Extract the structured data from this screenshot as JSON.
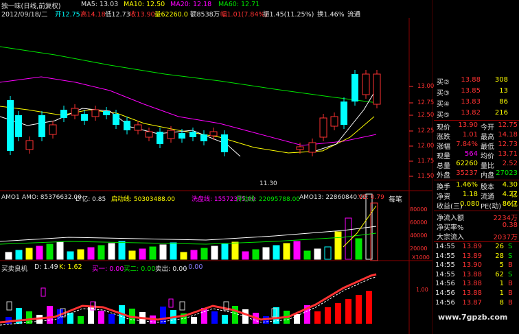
{
  "header": {
    "title": "独一味(日线,前复权)",
    "ma5": "MA5: 13.03",
    "ma10": "MA10: 12.50",
    "ma20": "MA20: 12.18",
    "ma60": "MA60: 12.71",
    "date": "2012/09/18/二",
    "open": "开12.75",
    "high": "高14.18",
    "low": "低12.73",
    "close": "收13.90",
    "volume": "量62260.0",
    "amount": "额8538万",
    "change": "幅1.01(7.84%)",
    "amplitude": "振1.45(11.25%)",
    "turnover": "换1.46%",
    "liquidity": "流通"
  },
  "price_axis": [
    "13.00",
    "12.75",
    "12.50",
    "12.25",
    "12.00",
    "11.75",
    "11.50"
  ],
  "low_marker": "11.30",
  "amo_panel": {
    "label": "AMO1",
    "amo": "AMO: 85376632.00",
    "lt": "LT亿: 0.85",
    "start": "启动线: 50303488.00",
    "wash": "洗盘线: 15572375.00",
    "move": "异动线: 22095788.00",
    "amo13": "AMO13: 22860840.00",
    "v2": "V2: 0.79",
    "tag": "每笔",
    "axis": [
      "80000",
      "60000",
      "40000",
      "20000"
    ],
    "unit": "X1000"
  },
  "timing_panel": {
    "label": "买卖良机",
    "d": "D: 1.49",
    "k": "K: 1.62",
    "buy1": "买一: 0.00",
    "buy2": "买二: 0.00",
    "sell": "卖出: 0.00",
    "dot": ": 0.00",
    "axis": "1.00"
  },
  "order_book": {
    "bids": [
      {
        "label": "买②",
        "price": "13.88",
        "vol": "308"
      },
      {
        "label": "买③",
        "price": "13.85",
        "vol": "13"
      },
      {
        "label": "买④",
        "price": "13.83",
        "vol": "86"
      },
      {
        "label": "买⑤",
        "price": "13.82",
        "vol": "216"
      }
    ],
    "stats": [
      {
        "l1": "现价",
        "v1": "13.90",
        "l2": "今开",
        "v2": "12.75"
      },
      {
        "l1": "涨跌",
        "v1": "1.01",
        "l2": "最高",
        "v2": "14.18"
      },
      {
        "l1": "涨幅",
        "v1": "7.84%",
        "l2": "最低",
        "v2": "12.73"
      },
      {
        "l1": "现量",
        "v1": "564",
        "l2": "均价",
        "v2": "13.71"
      },
      {
        "l1": "总量",
        "v1": "62260",
        "l2": "量比",
        "v2": "2.52"
      },
      {
        "l1": "外盘",
        "v1": "35237",
        "l2": "内盘",
        "v2": "27023"
      },
      {
        "l1": "换手",
        "v1": "1.46%",
        "l2": "股本",
        "v2": "4.30亿"
      },
      {
        "l1": "净资",
        "v1": "1.18",
        "l2": "流通",
        "v2": "4.27亿"
      },
      {
        "l1": "收益(三)",
        "v1": "0.080",
        "l2": "PE(动)",
        "v2": "86.7"
      }
    ],
    "flows": [
      {
        "l": "净流入额",
        "v": "2234万"
      },
      {
        "l": "净买率%",
        "v": "0.38"
      },
      {
        "l": "大宗流入",
        "v": "2037万"
      }
    ],
    "ticks": [
      {
        "t": "14:55",
        "p": "13.89",
        "v": "26",
        "s": "S"
      },
      {
        "t": "14:55",
        "p": "13.89",
        "v": "28",
        "s": "S"
      },
      {
        "t": "14:55",
        "p": "13.90",
        "v": "5",
        "s": "B"
      },
      {
        "t": "14:55",
        "p": "13.88",
        "v": "62",
        "s": "S"
      },
      {
        "t": "14:56",
        "p": "13.88",
        "v": "1",
        "s": "B"
      },
      {
        "t": "14:56",
        "p": "13.88",
        "v": "1",
        "s": "B"
      },
      {
        "t": "14:56",
        "p": "13.87",
        "v": "8",
        "s": "B"
      }
    ]
  },
  "watermark": "www.7gpzb.com",
  "colors": {
    "up": "#ff3232",
    "down": "#00ffff",
    "ma5": "#ffffff",
    "ma10": "#ffff00",
    "ma20": "#ff00ff",
    "ma60": "#00e600"
  }
}
